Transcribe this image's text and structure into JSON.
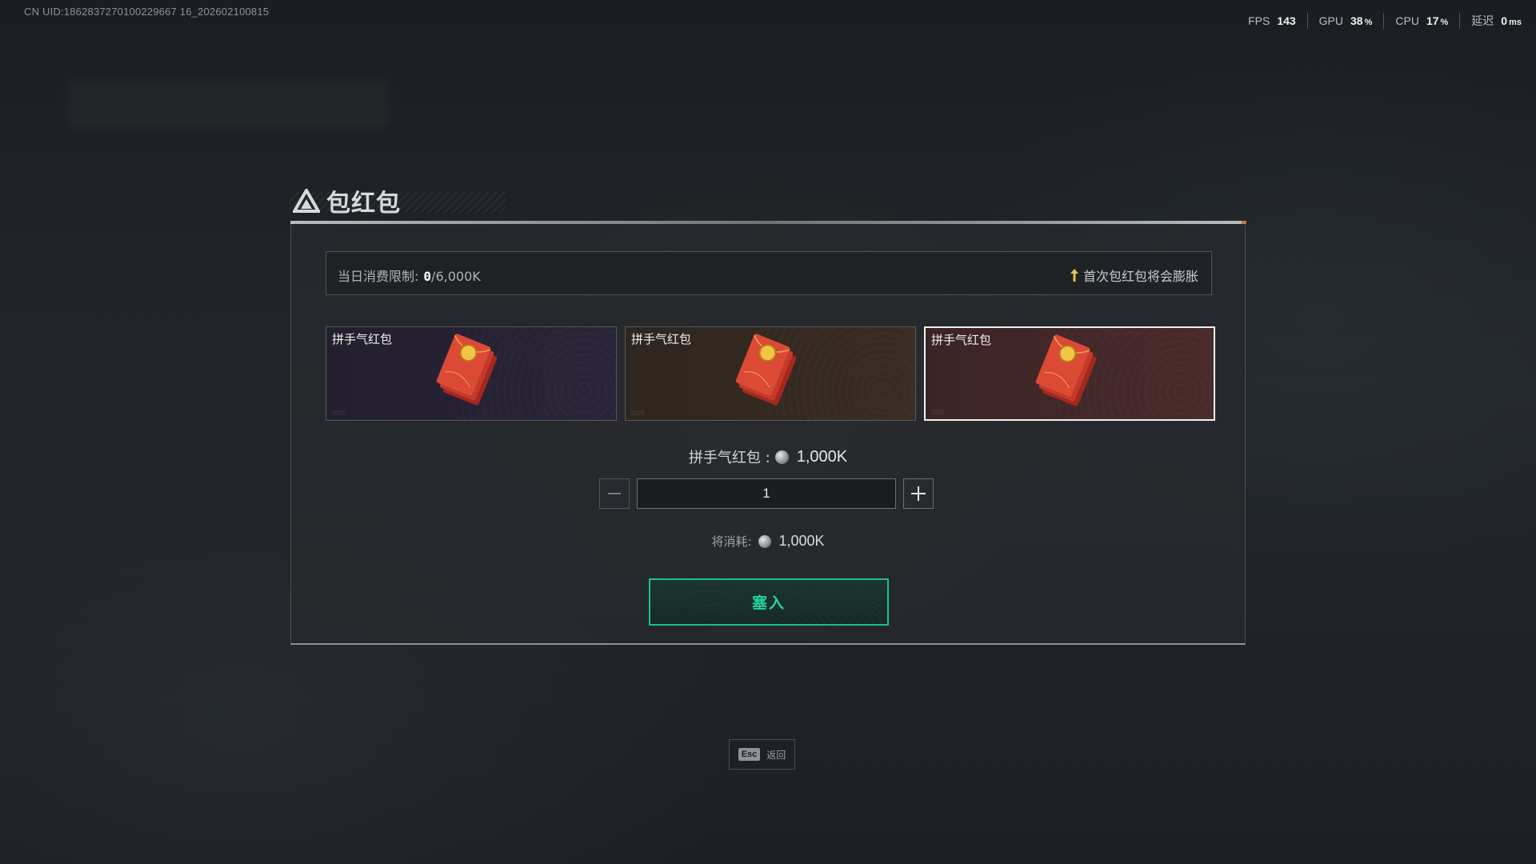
{
  "uid_text": "CN UID:1862837270100229667 16_202602100815",
  "perf": {
    "fps_label": "FPS",
    "fps_value": "143",
    "gpu_label": "GPU",
    "gpu_value": "38",
    "gpu_unit": "%",
    "cpu_label": "CPU",
    "cpu_value": "17",
    "cpu_unit": "%",
    "latency_label": "延迟",
    "latency_value": "0",
    "latency_unit": "ms"
  },
  "dialog": {
    "title": "包红包",
    "limit": {
      "label": "当日消费限制:",
      "current": "0",
      "max": "/6,000K",
      "hint": "首次包红包将会膨胀"
    },
    "cards": [
      {
        "label": "拼手气红包",
        "selected": false
      },
      {
        "label": "拼手气红包",
        "selected": false
      },
      {
        "label": "拼手气红包",
        "selected": true
      }
    ],
    "price": {
      "label": "拼手气红包 :",
      "value": "1,000K"
    },
    "quantity": "1",
    "cost": {
      "label": "将消耗:",
      "value": "1,000K"
    },
    "confirm_label": "塞入"
  },
  "footer": {
    "esc_key": "Esc",
    "esc_label": "返回"
  },
  "colors": {
    "accent_green": "#18c28a",
    "hint_arrow": "#e6c34a"
  }
}
